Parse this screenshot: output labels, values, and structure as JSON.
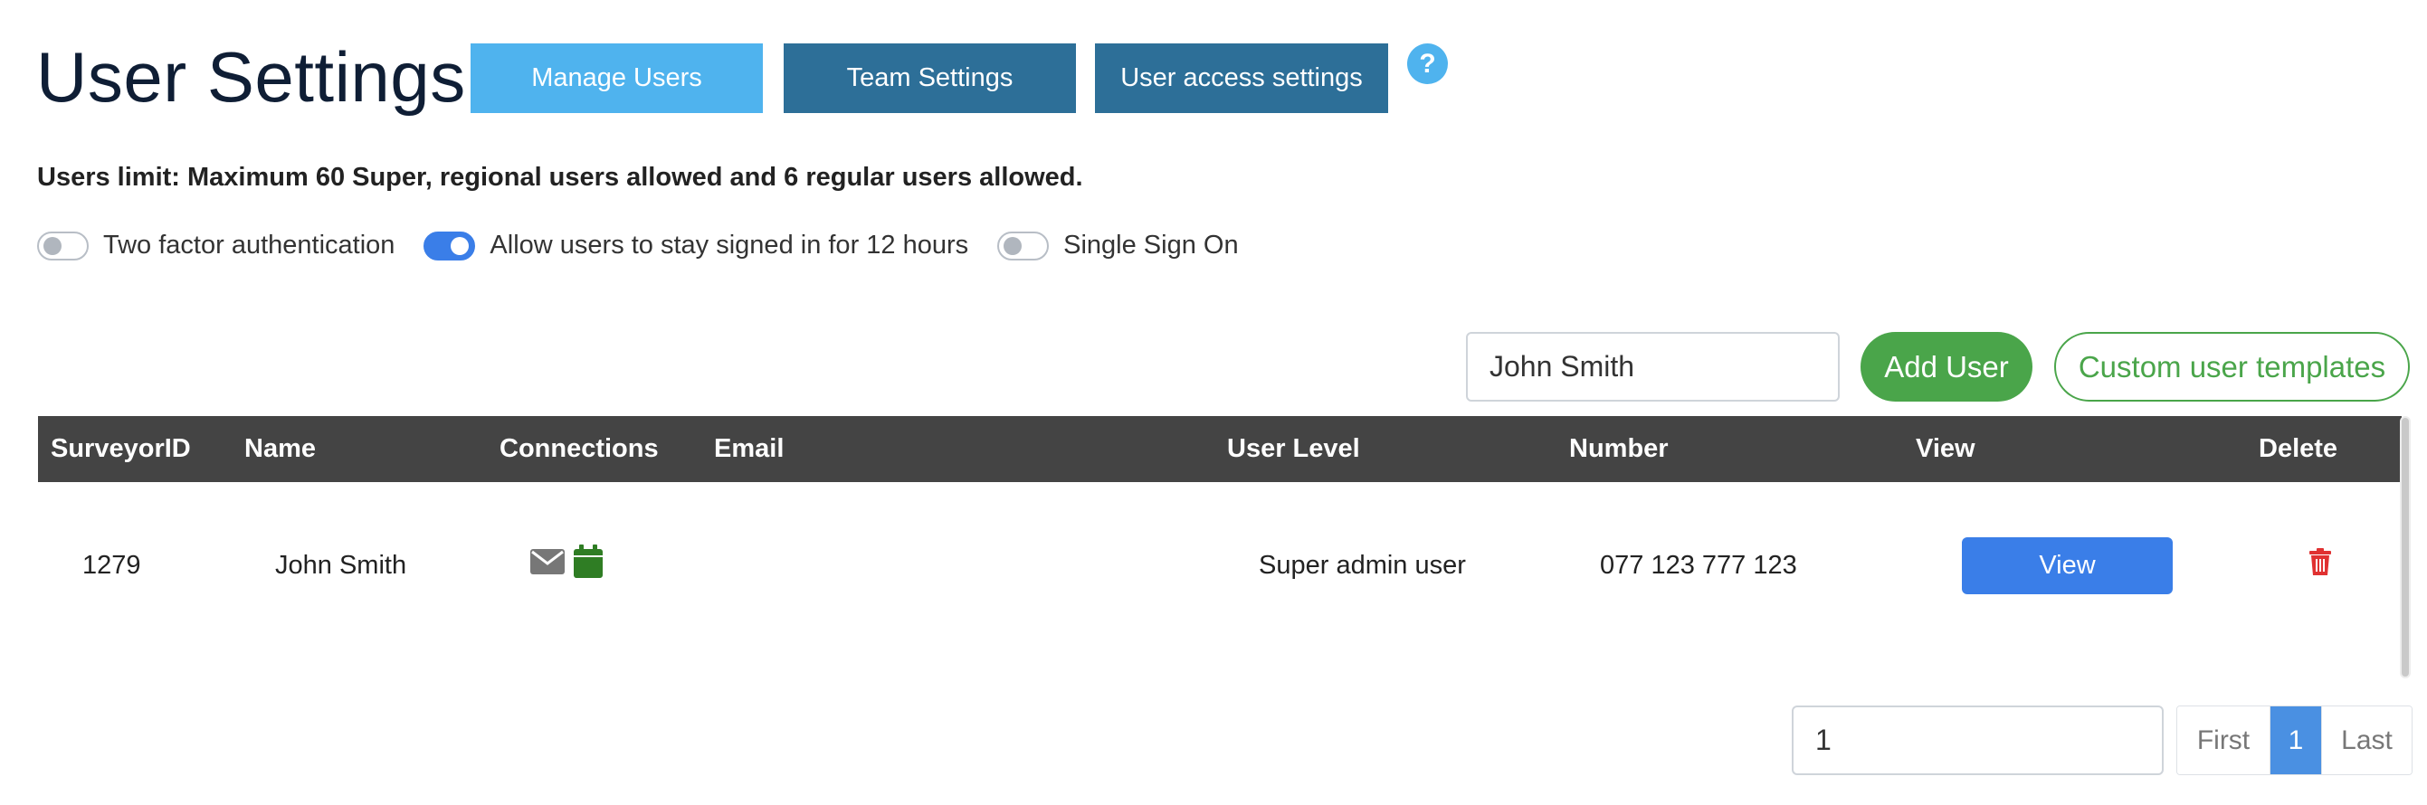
{
  "page": {
    "title": "User Settings",
    "tabs": [
      {
        "label": "Manage Users"
      },
      {
        "label": "Team Settings"
      },
      {
        "label": "User access settings"
      }
    ],
    "help_icon": "question-circle-icon",
    "help_glyph": "?"
  },
  "limit_text": "Users limit: Maximum 60 Super, regional users allowed and 6 regular users allowed.",
  "toggles": [
    {
      "label": "Two factor authentication",
      "enabled": false
    },
    {
      "label": "Allow users to stay signed in for 12 hours",
      "enabled": true
    },
    {
      "label": "Single Sign On",
      "enabled": false
    }
  ],
  "search": {
    "value": "John Smith"
  },
  "buttons": {
    "add_user": "Add User",
    "custom_templates": "Custom user templates"
  },
  "table": {
    "columns": [
      "SurveyorID",
      "Name",
      "Connections",
      "Email",
      "User Level",
      "Number",
      "View",
      "Delete"
    ],
    "rows": [
      {
        "surveyor_id": "1279",
        "name": "John Smith",
        "connections": [
          "mail-icon",
          "calendar-icon"
        ],
        "email": "",
        "user_level": "Super admin user",
        "number": "077 123 777 123",
        "view_label": "View",
        "delete_icon": "trash-icon"
      }
    ]
  },
  "pagination": {
    "page_input_value": "1",
    "first_label": "First",
    "current_page": "1",
    "last_label": "Last"
  },
  "colors": {
    "tab_active": "#4fb3ee",
    "tab_inactive": "#2d6f98",
    "green": "#4aa54a",
    "blue": "#3a7ee8",
    "table_header": "#444444",
    "delete_red": "#e03131",
    "calendar_green": "#2f7d24",
    "mail_gray": "#777777"
  }
}
